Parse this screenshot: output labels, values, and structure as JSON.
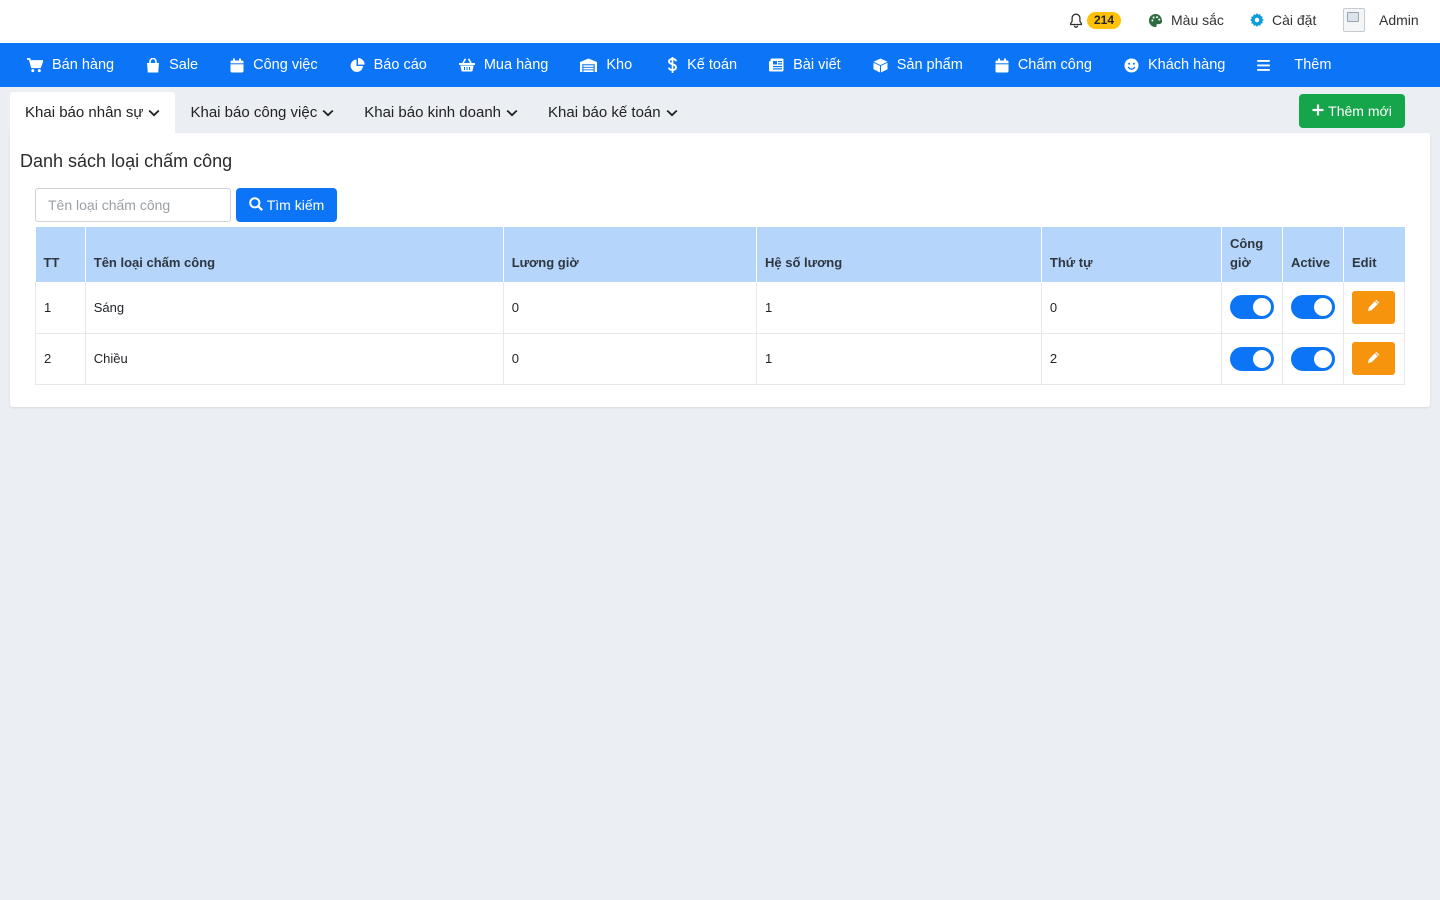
{
  "topbar": {
    "notification_count": "214",
    "color_label": "Màu sắc",
    "settings_label": "Cài đặt",
    "user_label": "Admin"
  },
  "nav": [
    {
      "label": "Bán hàng",
      "icon": "cart-icon"
    },
    {
      "label": "Sale",
      "icon": "shopping-bag-icon"
    },
    {
      "label": "Công việc",
      "icon": "calendar-icon"
    },
    {
      "label": "Báo cáo",
      "icon": "pie-chart-icon"
    },
    {
      "label": "Mua hàng",
      "icon": "basket-icon"
    },
    {
      "label": "Kho",
      "icon": "warehouse-icon"
    },
    {
      "label": "Kế toán",
      "icon": "dollar-icon"
    },
    {
      "label": "Bài viết",
      "icon": "newspaper-icon"
    },
    {
      "label": "Sản phẩm",
      "icon": "box-icon"
    },
    {
      "label": "Chấm công",
      "icon": "calendar-icon"
    },
    {
      "label": "Khách hàng",
      "icon": "smile-icon"
    },
    {
      "label": "Thêm",
      "icon": "menu-icon"
    }
  ],
  "subtabs": [
    {
      "label": "Khai báo nhân sự"
    },
    {
      "label": "Khai báo công việc"
    },
    {
      "label": "Khai báo kinh doanh"
    },
    {
      "label": "Khai báo kế toán"
    }
  ],
  "add_button": "Thêm mới",
  "panel": {
    "title": "Danh sách loại chấm công",
    "search_placeholder": "Tên loại chấm công",
    "search_button": "Tìm kiếm"
  },
  "table": {
    "headers": {
      "tt": "TT",
      "name": "Tên loại chấm công",
      "hourly": "Lương giờ",
      "coef": "Hệ số lương",
      "order": "Thứ tự",
      "cong_gio_1": "Công",
      "cong_gio_2": "giờ",
      "active": "Active",
      "edit": "Edit"
    },
    "rows": [
      {
        "tt": "1",
        "name": "Sáng",
        "hourly": "0",
        "coef": "1",
        "order": "0",
        "cong_gio": true,
        "active": true
      },
      {
        "tt": "2",
        "name": "Chiều",
        "hourly": "0",
        "coef": "1",
        "order": "2",
        "cong_gio": true,
        "active": true
      }
    ]
  },
  "colors": {
    "primary": "#0b74f7",
    "success": "#15a54a",
    "warning": "#f7940e",
    "badge": "#ffc107",
    "table_header": "#b5d5fb"
  }
}
